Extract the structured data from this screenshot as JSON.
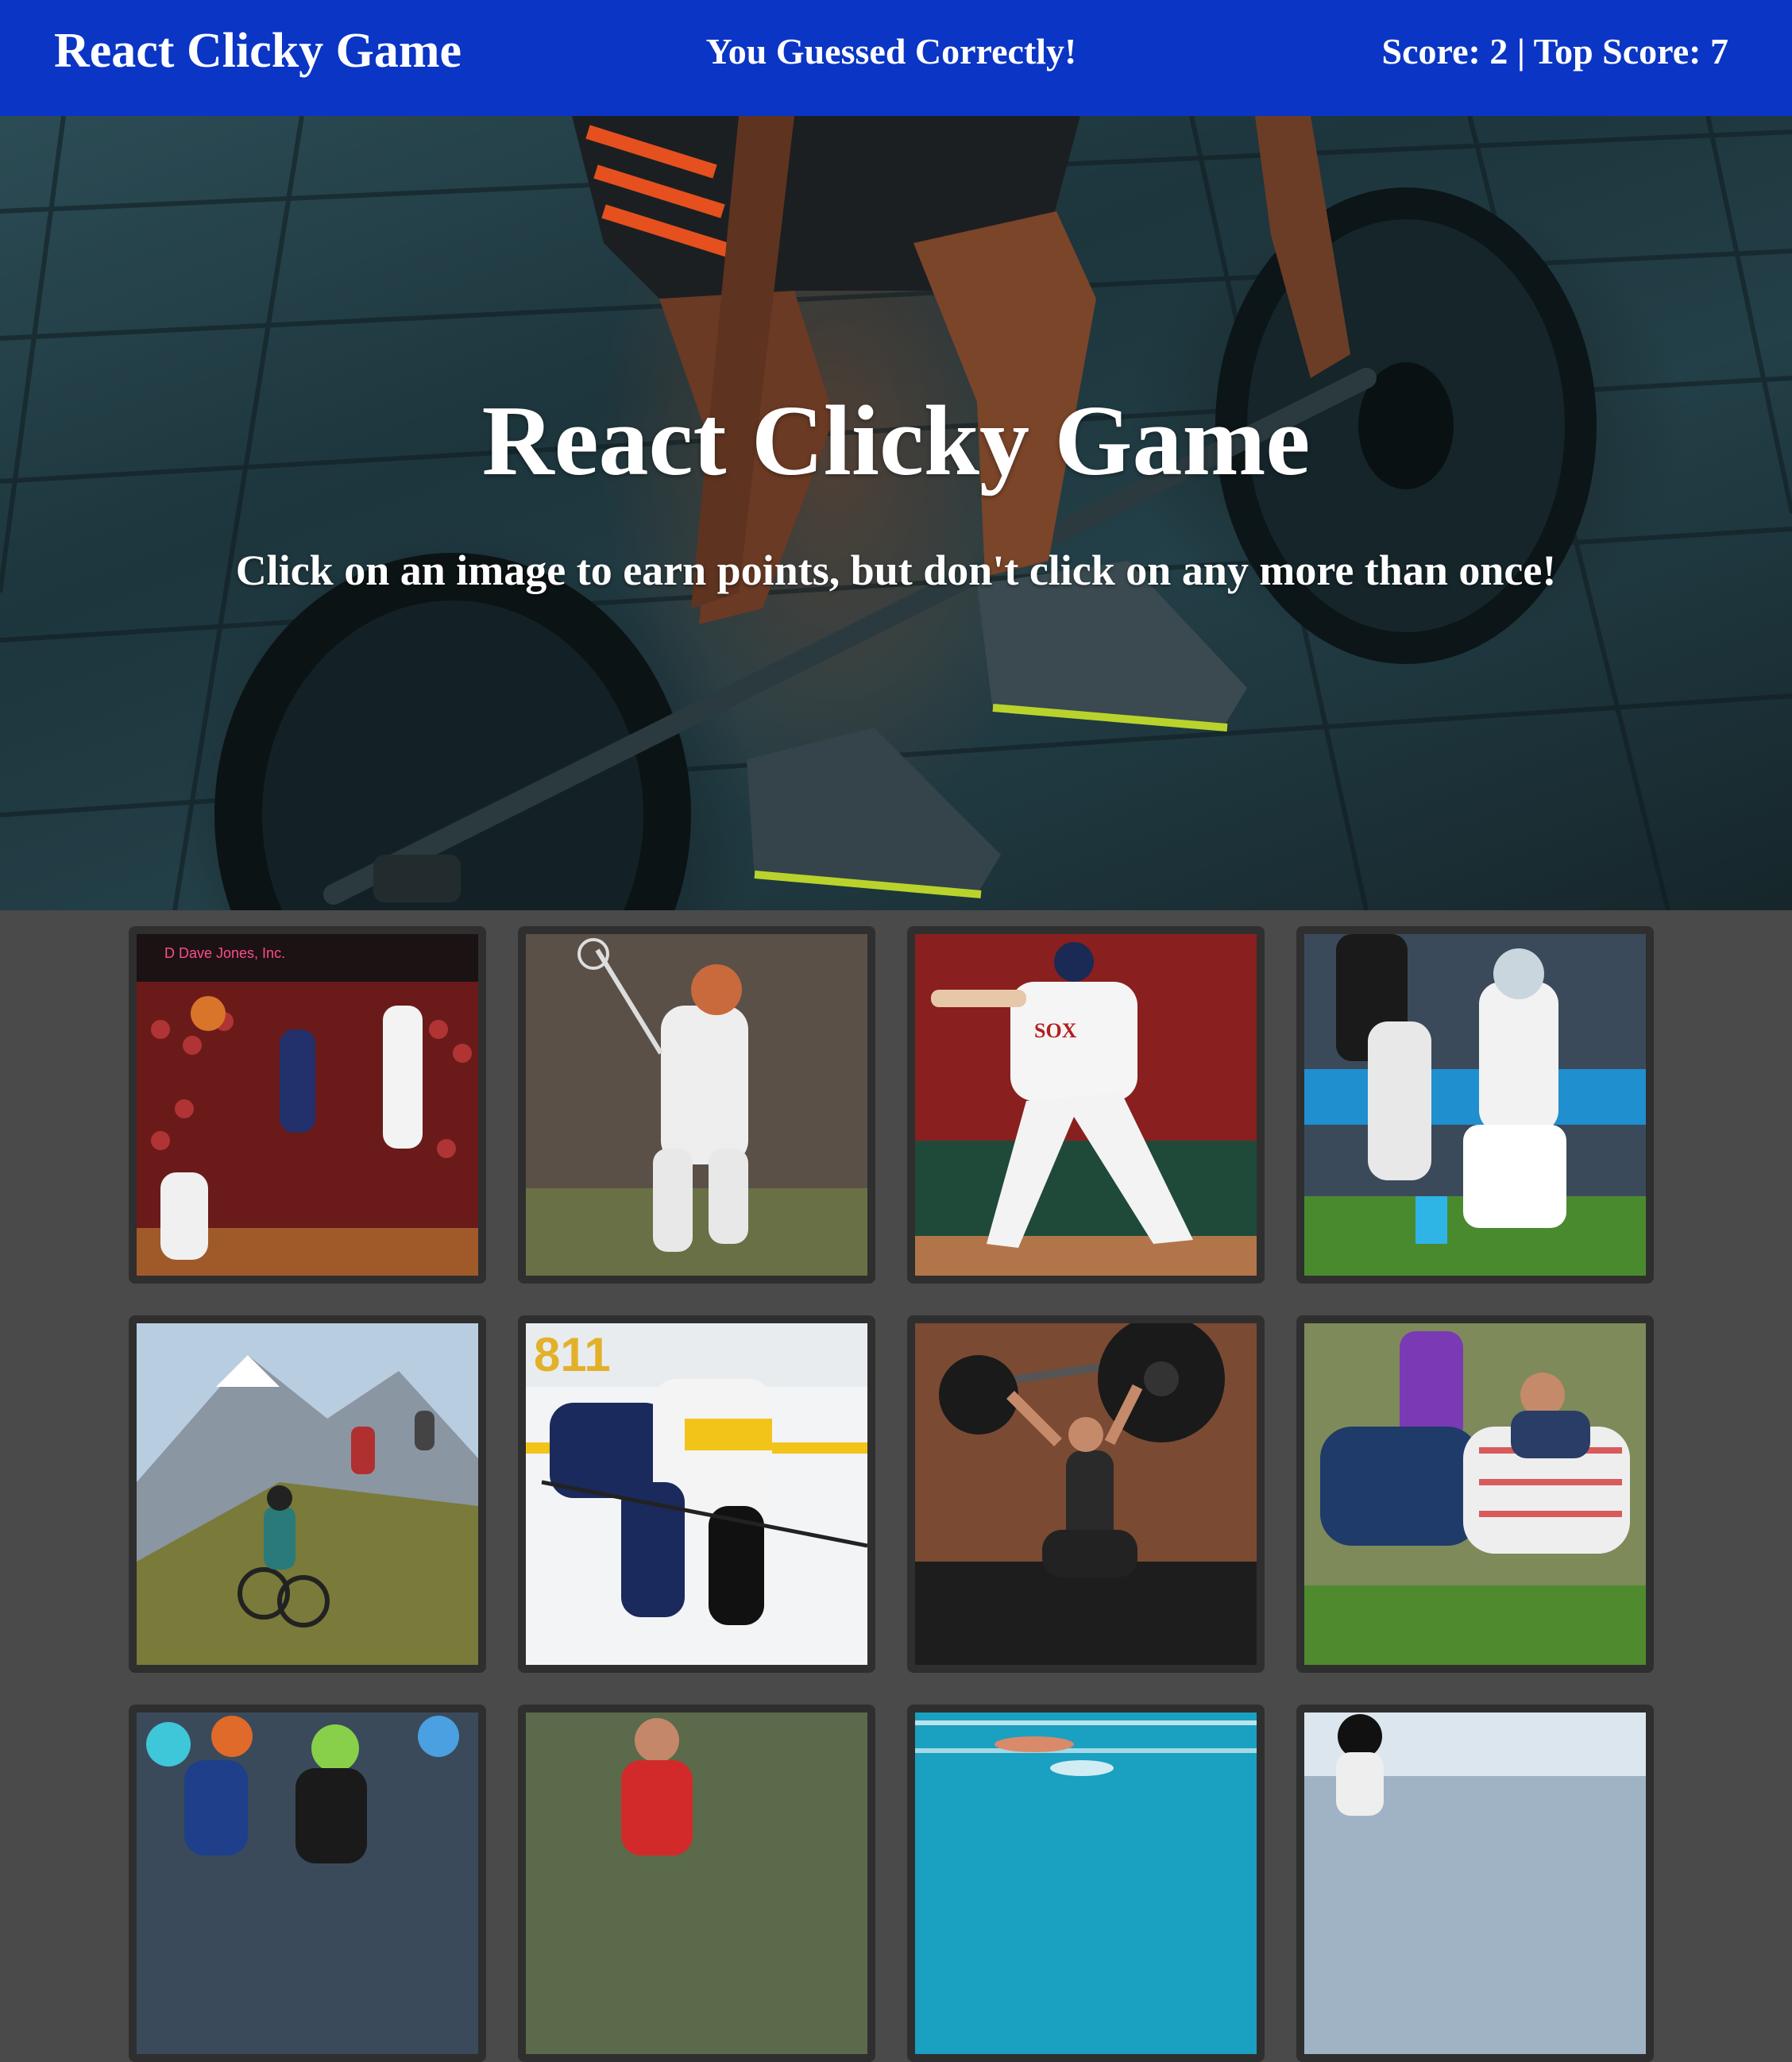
{
  "navbar": {
    "brand": "React Clicky Game",
    "status": "You Guessed Correctly!",
    "score_text": "Score: 2 | Top Score: 7"
  },
  "hero": {
    "title": "React Clicky Game",
    "subtitle": "Click on an image to earn points, but don't click on any more than once!",
    "background_icon": "weightlifting-photo"
  },
  "cards": [
    {
      "icon": "basketball-photo"
    },
    {
      "icon": "lacrosse-photo"
    },
    {
      "icon": "baseball-photo"
    },
    {
      "icon": "football-photo"
    },
    {
      "icon": "mountain-biking-photo"
    },
    {
      "icon": "hockey-photo"
    },
    {
      "icon": "weightlifting-photo"
    },
    {
      "icon": "rugby-photo"
    },
    {
      "icon": "cycling-photo"
    },
    {
      "icon": "soccer-photo"
    },
    {
      "icon": "swimming-photo"
    },
    {
      "icon": "skiing-photo"
    }
  ],
  "colors": {
    "navbar": "#0b35c4",
    "page_background": "#4a4a4a",
    "card_frame": "#2f2f2f"
  }
}
